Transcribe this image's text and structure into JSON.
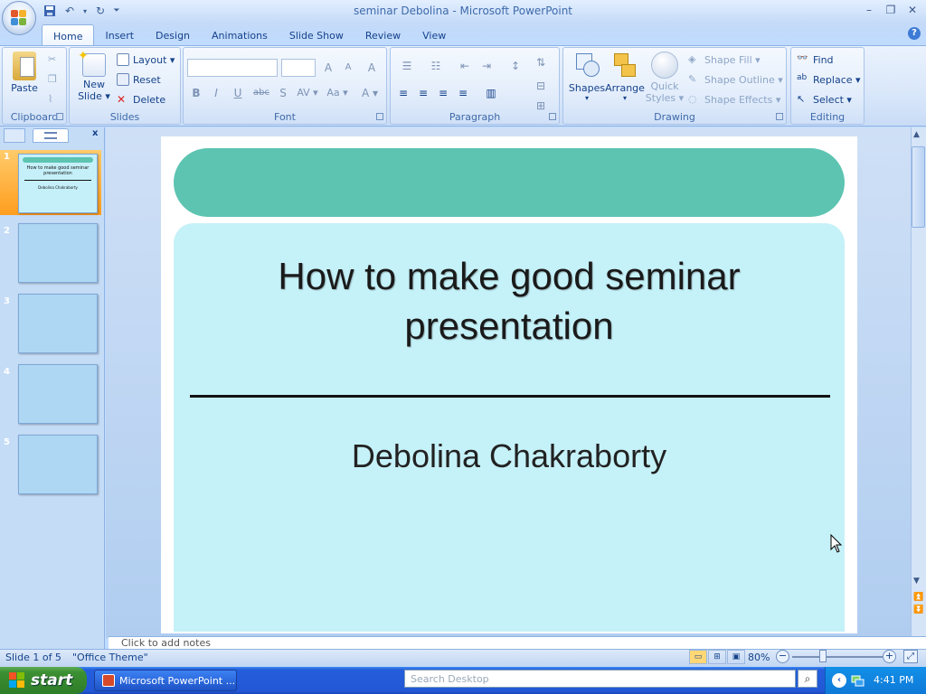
{
  "window": {
    "title": "seminar Debolina - Microsoft PowerPoint",
    "controls": {
      "minimize": "–",
      "restore": "❐",
      "close": "✕"
    }
  },
  "qat": {
    "save_icon": "save-icon",
    "undo_icon": "undo-icon",
    "redo_icon": "redo-icon",
    "customize_icon": "chevron-down-icon"
  },
  "tabs": [
    "Home",
    "Insert",
    "Design",
    "Animations",
    "Slide Show",
    "Review",
    "View"
  ],
  "active_tab": "Home",
  "ribbon": {
    "clipboard": {
      "label": "Clipboard",
      "paste": "Paste"
    },
    "slides": {
      "label": "Slides",
      "new_slide_1": "New",
      "new_slide_2": "Slide ▾",
      "layout": "Layout ▾",
      "reset": "Reset",
      "delete": "Delete"
    },
    "font": {
      "label": "Font",
      "font_name": "",
      "font_size": "",
      "grow": "A",
      "shrink": "A",
      "clear": "A",
      "bold": "B",
      "italic": "I",
      "underline": "U",
      "strike": "abc",
      "shadow": "S",
      "spacing": "AV ▾",
      "case": "Aa ▾",
      "color": "A ▾"
    },
    "paragraph": {
      "label": "Paragraph"
    },
    "drawing": {
      "label": "Drawing",
      "shapes": "Shapes",
      "arrange": "Arrange",
      "quick_styles_1": "Quick",
      "quick_styles_2": "Styles ▾",
      "shape_fill": "Shape Fill ▾",
      "shape_outline": "Shape Outline ▾",
      "shape_effects": "Shape Effects ▾"
    },
    "editing": {
      "label": "Editing",
      "find": "Find",
      "replace": "Replace ▾",
      "select": "Select ▾"
    }
  },
  "slide_pane": {
    "close": "x",
    "thumbs": [
      {
        "num": "1",
        "title": "How to make good seminar presentation",
        "subtitle": "Debolina Chakraborty"
      },
      {
        "num": "2"
      },
      {
        "num": "3"
      },
      {
        "num": "4"
      },
      {
        "num": "5"
      }
    ]
  },
  "slide": {
    "title_line1": "How to make good seminar",
    "title_line2": "presentation",
    "subtitle": "Debolina Chakraborty",
    "colors": {
      "bar": "#5dc4b1",
      "body": "#c5f1f8"
    }
  },
  "notes": {
    "placeholder": "Click to add notes"
  },
  "status": {
    "slide_info": "Slide 1 of 5",
    "theme": "\"Office Theme\"",
    "zoom": "80%",
    "zoom_out": "−",
    "zoom_in": "+"
  },
  "taskbar": {
    "start": "start",
    "app": "Microsoft PowerPoint ...",
    "search_placeholder": "Search Desktop",
    "clock": "4:41 PM"
  }
}
